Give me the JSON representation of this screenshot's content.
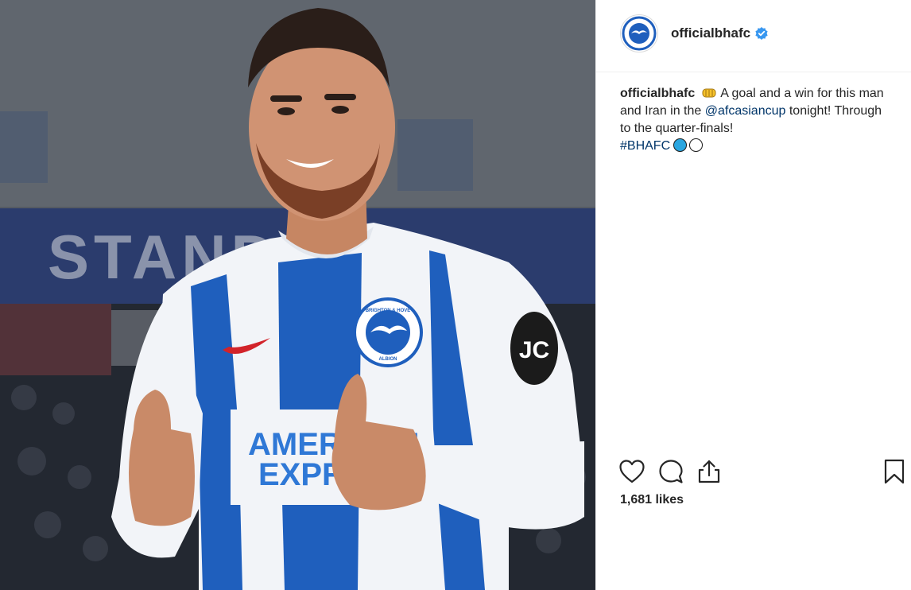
{
  "post": {
    "username": "officialbhafc",
    "verified": true,
    "caption": {
      "username": "officialbhafc",
      "emoji": "oncoming-fist",
      "text_1": "A goal and a win for this man and Iran in the",
      "mention": "@afcasiancup",
      "text_2": "tonight! Through to the quarter-finals!",
      "hashtag": "#BHAFC",
      "emoji_circles": [
        "blue-circle",
        "white-circle"
      ]
    },
    "likes": "1,681 likes",
    "actions": [
      "heart-icon",
      "comment-icon",
      "share-icon",
      "bookmark-icon"
    ]
  },
  "photo": {
    "banner_text": "STAND",
    "sponsor_line_1": "AMERICAN",
    "sponsor_line_2": "EXPRESS",
    "crest_top": "BRIGHTON & HOVE",
    "crest_bottom": "ALBION",
    "sleeve_badge": "JC",
    "colors": {
      "shirt_blue": "#1f5fbd",
      "shirt_white": "#f2f4f8",
      "nike_red": "#d2232a",
      "verified_blue": "#3897f0",
      "link_blue": "#003569"
    }
  }
}
